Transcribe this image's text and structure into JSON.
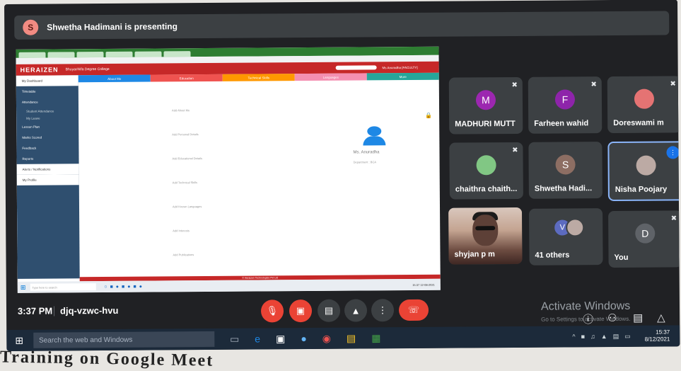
{
  "presenting": {
    "avatar_initial": "S",
    "text": "Shwetha Hadimani is presenting"
  },
  "shared_screen": {
    "app_logo": "HERAIZEN",
    "college": "Bhuyar/Alfa Degree College",
    "user": "Ms Anuradha [FACULTY]",
    "sidebar": [
      {
        "label": "My Dashboard",
        "style": "light"
      },
      {
        "label": "Timetable",
        "style": ""
      },
      {
        "label": "Attendance",
        "style": ""
      },
      {
        "label": "Student Attendance",
        "style": "sub"
      },
      {
        "label": "My Leave",
        "style": "sub"
      },
      {
        "label": "Lesson Plan",
        "style": ""
      },
      {
        "label": "Marks Scored",
        "style": ""
      },
      {
        "label": "Feedback",
        "style": ""
      },
      {
        "label": "Reports",
        "style": ""
      },
      {
        "label": "Alerts / Notifications",
        "style": "light"
      },
      {
        "label": "My Profile",
        "style": "light"
      }
    ],
    "tabs": [
      {
        "label": "About Me",
        "color": "#1e88e5"
      },
      {
        "label": "Education",
        "color": "#ef5350"
      },
      {
        "label": "Technical Skills",
        "color": "#ff9800"
      },
      {
        "label": "Languages",
        "color": "#f48fb1"
      },
      {
        "label": "More",
        "color": "#26a69a"
      }
    ],
    "content_lines": [
      "Add About Me",
      "Add Personal Details",
      "Add Educational Details",
      "Add Technical Skills",
      "Add Known Languages",
      "Add Interests",
      "Add Publications"
    ],
    "profile_name": "Ms. Anuradha",
    "profile_dept": "Department : BCA",
    "footer": "© Heraizen Technologies Pvt Ltd",
    "win_search": "Type here to search",
    "win_clock": "15:37 12-08-2021"
  },
  "participants": [
    {
      "name": "MADHURI MUTT",
      "initial": "M",
      "color": "#9c27b0",
      "muted": true
    },
    {
      "name": "Farheen wahid",
      "initial": "F",
      "color": "#8e24aa",
      "muted": true
    },
    {
      "name": "Doreswami m",
      "initial": "",
      "color": "#e57373",
      "muted": true
    },
    {
      "name": "chaithra chaith...",
      "initial": "",
      "color": "#81c784",
      "muted": true
    },
    {
      "name": "Shwetha Hadi...",
      "initial": "S",
      "color": "#8d6e63",
      "muted": false
    },
    {
      "name": "Nisha Poojary",
      "initial": "",
      "color": "#bcaaa4",
      "muted": false
    },
    {
      "name": "shyjan p m",
      "initial": "",
      "color": "",
      "muted": false
    },
    {
      "name": "41 others",
      "initial": "V",
      "color": "#5c6bc0",
      "muted": false
    },
    {
      "name": "You",
      "initial": "D",
      "color": "#5f6368",
      "muted": true
    }
  ],
  "meeting": {
    "time": "3:37 PM",
    "code": "djq-vzwc-hvu"
  },
  "activate": {
    "title": "Activate Windows",
    "subtitle": "Go to Settings to activate Windows."
  },
  "taskbar": {
    "search_placeholder": "Search the web and Windows",
    "clock_time": "15:37",
    "clock_date": "8/12/2021"
  },
  "caption": "Training on Google Meet",
  "icons": {
    "mic_off": "mic-off-icon",
    "cam_off": "camera-off-icon",
    "cc": "captions-icon",
    "present": "present-icon",
    "more": "more-options-icon",
    "end": "end-call-icon"
  }
}
